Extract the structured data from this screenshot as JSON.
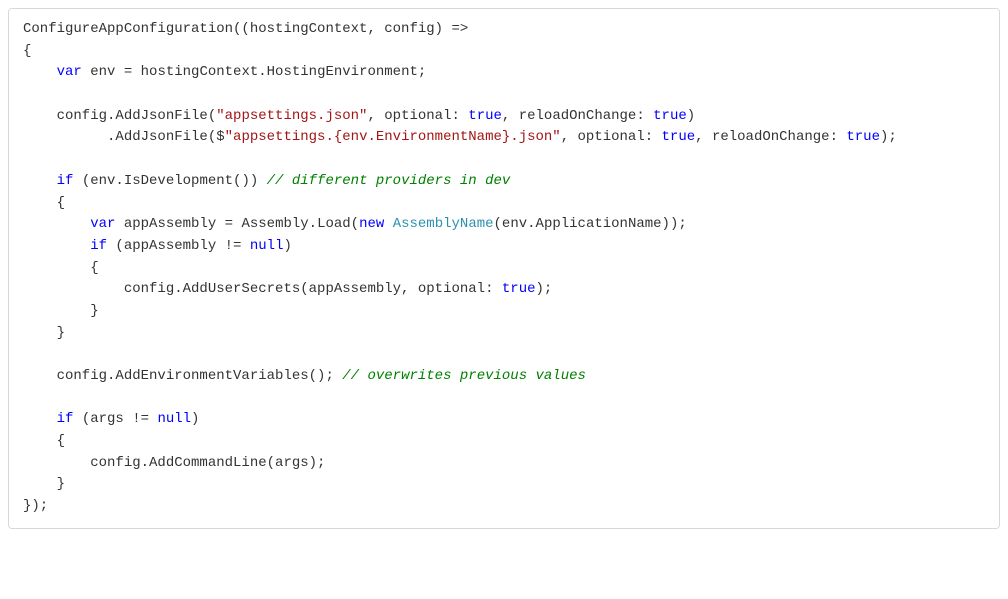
{
  "code": {
    "l1_a": "ConfigureAppConfiguration((hostingContext, config) =>",
    "l2_a": "{",
    "l3_kw": "var",
    "l3_b": " env = hostingContext.HostingEnvironment;",
    "l5_a": "    config.AddJsonFile(",
    "l5_s1": "\"appsettings.json\"",
    "l5_b": ", optional: ",
    "l5_kw1": "true",
    "l5_c": ", reloadOnChange: ",
    "l5_kw2": "true",
    "l5_d": ")",
    "l6_a": "          .AddJsonFile($",
    "l6_s1": "\"appsettings.{env.EnvironmentName}.json\"",
    "l6_b": ", optional: ",
    "l6_kw1": "true",
    "l6_c": ", reloadOnChange: ",
    "l6_kw2": "true",
    "l6_d": ");",
    "l8_kw": "if",
    "l8_a": " (env.IsDevelopment()) ",
    "l8_c": "// different providers in dev",
    "l9_a": "    {",
    "l10_kw": "var",
    "l10_a": " appAssembly = Assembly.Load(",
    "l10_kw2": "new",
    "l10_sp": " ",
    "l10_t": "AssemblyName",
    "l10_b": "(env.ApplicationName));",
    "l11_kw": "if",
    "l11_a": " (appAssembly != ",
    "l11_kw2": "null",
    "l11_b": ")",
    "l12_a": "        {",
    "l13_a": "            config.AddUserSecrets(appAssembly, optional: ",
    "l13_kw": "true",
    "l13_b": ");",
    "l14_a": "        }",
    "l15_a": "    }",
    "l17_a": "    config.AddEnvironmentVariables(); ",
    "l17_c": "// overwrites previous values",
    "l19_kw": "if",
    "l19_a": " (args != ",
    "l19_kw2": "null",
    "l19_b": ")",
    "l20_a": "    {",
    "l21_a": "        config.AddCommandLine(args);",
    "l22_a": "    }",
    "l23_a": "});"
  }
}
